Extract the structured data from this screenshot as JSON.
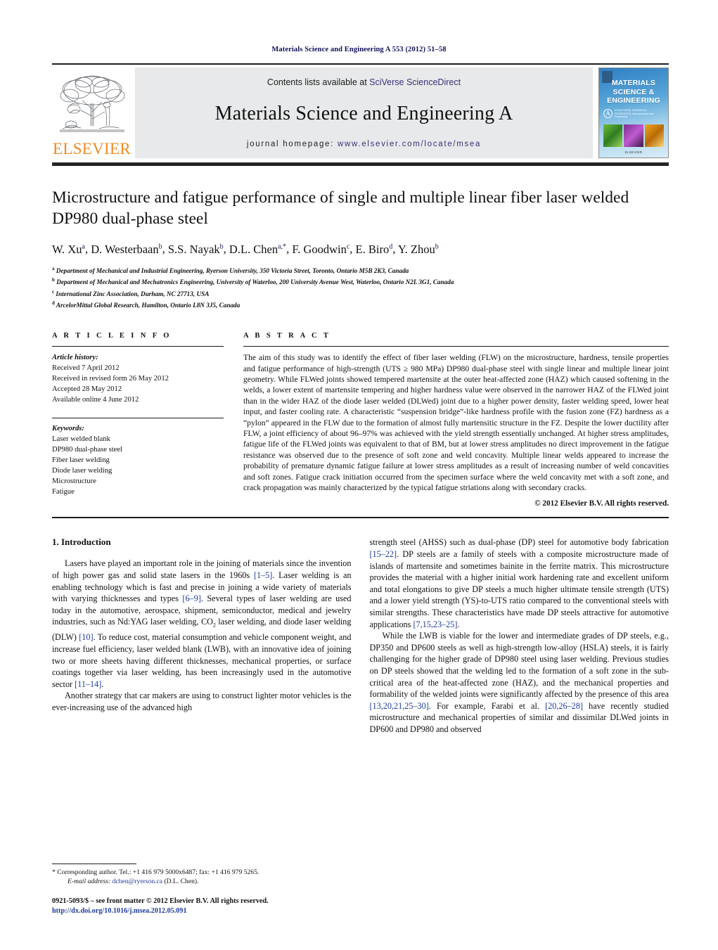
{
  "running_head": "Materials Science and Engineering A 553 (2012) 51–58",
  "masthead": {
    "publisher_logo_text": "ELSEVIER",
    "contents_prefix": "Contents lists available at ",
    "contents_link": "SciVerse ScienceDirect",
    "journal_name": "Materials Science and Engineering A",
    "homepage_prefix": "journal homepage: ",
    "homepage_link": "www.elsevier.com/locate/msea",
    "cover": {
      "line1": "MATERIALS",
      "line2": "SCIENCE &",
      "line3": "ENGINEERING",
      "badge_letter": "A",
      "badge_sub": "STRUCTURAL MATERIALS: PROPERTIES, Microstructure and Processing",
      "footer": "ELSEVIER"
    }
  },
  "title": "Microstructure and fatigue performance of single and multiple linear fiber laser welded DP980 dual-phase steel",
  "authors": [
    {
      "name": "W. Xu",
      "sup": "a"
    },
    {
      "name": "D. Westerbaan",
      "sup": "b"
    },
    {
      "name": "S.S. Nayak",
      "sup": "b"
    },
    {
      "name": "D.L. Chen",
      "sup": "a,*"
    },
    {
      "name": "F. Goodwin",
      "sup": "c"
    },
    {
      "name": "E. Biro",
      "sup": "d"
    },
    {
      "name": "Y. Zhou",
      "sup": "b"
    }
  ],
  "affiliations": [
    {
      "mark": "a",
      "text": "Department of Mechanical and Industrial Engineering, Ryerson University, 350 Victoria Street, Toronto, Ontario M5B 2K3, Canada"
    },
    {
      "mark": "b",
      "text": "Department of Mechanical and Mechatronics Engineering, University of Waterloo, 200 University Avenue West, Waterloo, Ontario N2L 3G1, Canada"
    },
    {
      "mark": "c",
      "text": "International Zinc Association, Durham, NC 27713, USA"
    },
    {
      "mark": "d",
      "text": "ArcelorMittal Global Research, Hamilton, Ontario L8N 3J5, Canada"
    }
  ],
  "article_info": {
    "heading": "A R T I C L E   I N F O",
    "history_label": "Article history:",
    "history": [
      "Received 7 April 2012",
      "Received in revised form 26 May 2012",
      "Accepted 28 May 2012",
      "Available online 4 June 2012"
    ],
    "keywords_label": "Keywords:",
    "keywords": [
      "Laser welded blank",
      "DP980 dual-phase steel",
      "Fiber laser welding",
      "Diode laser welding",
      "Microstructure",
      "Fatigue"
    ]
  },
  "abstract": {
    "heading": "A B S T R A C T",
    "text": "The aim of this study was to identify the effect of fiber laser welding (FLW) on the microstructure, hardness, tensile properties and fatigue performance of high-strength (UTS ≥ 980 MPa) DP980 dual-phase steel with single linear and multiple linear joint geometry. While FLWed joints showed tempered martensite at the outer heat-affected zone (HAZ) which caused softening in the welds, a lower extent of martensite tempering and higher hardness value were observed in the narrower HAZ of the FLWed joint than in the wider HAZ of the diode laser welded (DLWed) joint due to a higher power density, faster welding speed, lower heat input, and faster cooling rate. A characteristic “suspension bridge”-like hardness profile with the fusion zone (FZ) hardness as a “pylon” appeared in the FLW due to the formation of almost fully martensitic structure in the FZ. Despite the lower ductility after FLW, a joint efficiency of about 96–97% was achieved with the yield strength essentially unchanged. At higher stress amplitudes, fatigue life of the FLWed joints was equivalent to that of BM, but at lower stress amplitudes no direct improvement in the fatigue resistance was observed due to the presence of soft zone and weld concavity. Multiple linear welds appeared to increase the probability of premature dynamic fatigue failure at lower stress amplitudes as a result of increasing number of weld concavities and soft zones. Fatigue crack initiation occurred from the specimen surface where the weld concavity met with a soft zone, and crack propagation was mainly characterized by the typical fatigue striations along with secondary cracks.",
    "copyright": "© 2012 Elsevier B.V. All rights reserved."
  },
  "introduction": {
    "number_title": "1.  Introduction",
    "para1_a": "Lasers have played an important role in the joining of materials since the invention of high power gas and solid state lasers in the 1960s ",
    "para1_ref1": "[1–5]",
    "para1_b": ". Laser welding is an enabling technology which is fast and precise in joining a wide variety of materials with varying thicknesses and types ",
    "para1_ref2": "[6–9]",
    "para1_c": ". Several types of laser welding are used today in the automotive, aerospace, shipment, semiconductor, medical and jewelry industries, such as Nd:YAG laser welding, CO",
    "para1_sub": "2",
    "para1_d": " laser welding, and diode laser welding (DLW) ",
    "para1_ref3": "[10]",
    "para1_e": ". To reduce cost, material consumption and vehicle component weight, and increase fuel efficiency, laser welded blank (LWB), with an innovative idea of joining two or more sheets having different thicknesses, mechanical properties, or surface coatings together via laser welding, has been increasingly used in the automotive sector ",
    "para1_ref4": "[11–14]",
    "para1_f": ".",
    "para2": "Another strategy that car makers are using to construct lighter motor vehicles is the ever-increasing use of the advanced high",
    "para3_a": "strength steel (AHSS) such as dual-phase (DP) steel for automotive body fabrication ",
    "para3_ref1": "[15–22]",
    "para3_b": ". DP steels are a family of steels with a composite microstructure made of islands of martensite and sometimes bainite in the ferrite matrix. This microstructure provides the material with a higher initial work hardening rate and excellent uniform and total elongations to give DP steels a much higher ultimate tensile strength (UTS) and a lower yield strength (YS)-to-UTS ratio compared to the conventional steels with similar strengths. These characteristics have made DP steels attractive for automotive applications ",
    "para3_ref2": "[7,15,23–25]",
    "para3_c": ".",
    "para4_a": "While the LWB is viable for the lower and intermediate grades of DP steels, e.g., DP350 and DP600 steels as well as high-strength low-alloy (HSLA) steels, it is fairly challenging for the higher grade of DP980 steel using laser welding. Previous studies on DP steels showed that the welding led to the formation of a soft zone in the sub-critical area of the heat-affected zone (HAZ), and the mechanical properties and formability of the welded joints were significantly affected by the presence of this area ",
    "para4_ref1": "[13,20,21,25–30]",
    "para4_b": ". For example, Farabi et al. ",
    "para4_ref2": "[20,26–28]",
    "para4_c": " have recently studied microstructure and mechanical properties of similar and dissimilar DLWed joints in DP600 and DP980 and observed"
  },
  "footer": {
    "corresponding": "* Corresponding author. Tel.: +1 416 979 5000x6487; fax: +1 416 979 5265.",
    "email_label": "E-mail address:",
    "email": "dchen@ryerson.ca",
    "email_suffix": "(D.L. Chen).",
    "issn_line": "0921-5093/$ – see front matter © 2012 Elsevier B.V. All rights reserved.",
    "doi": "http://dx.doi.org/10.1016/j.msea.2012.05.091"
  },
  "colors": {
    "link_blue": "#33337a",
    "ref_blue": "#1f3b9b",
    "elsevier_orange": "#f08a24",
    "running_head_navy": "#13125a",
    "band_grey": "#e8e9ea"
  }
}
